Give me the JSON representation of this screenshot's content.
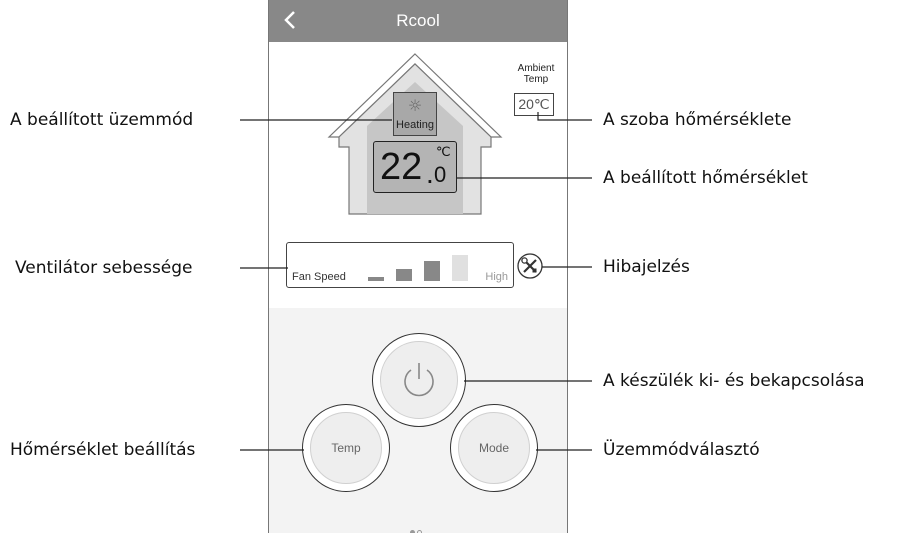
{
  "app": {
    "title": "Rcool"
  },
  "ambient": {
    "label_line1": "Ambient",
    "label_line2": "Temp",
    "value": "20℃"
  },
  "mode": {
    "label": "Heating",
    "icon": "sun-icon"
  },
  "set_temp": {
    "integer": "22",
    "decimal": "0",
    "unit": "℃"
  },
  "fan": {
    "label": "Fan Speed",
    "max_label": "High",
    "level": 3,
    "levels": 4
  },
  "buttons": {
    "temp": "Temp",
    "mode": "Mode",
    "power_icon": "power-icon"
  },
  "pager": {
    "pages": 2,
    "current": 1
  },
  "callouts": {
    "mode": "A beállított üzemmód",
    "fan": "Ventilátor sebessége",
    "temp_setting": "Hőmérséklet beállítás",
    "room_temp": "A szoba hőmérséklete",
    "set_temp": "A beállított hőmérséklet",
    "fault": "Hibajelzés",
    "power": "A készülék ki- és bekapcsolása",
    "mode_select": "Üzemmódválasztó"
  },
  "colors": {
    "header": "#888888",
    "lower_panel": "#f3f3f3",
    "display_fill": "#b4b4b4"
  }
}
